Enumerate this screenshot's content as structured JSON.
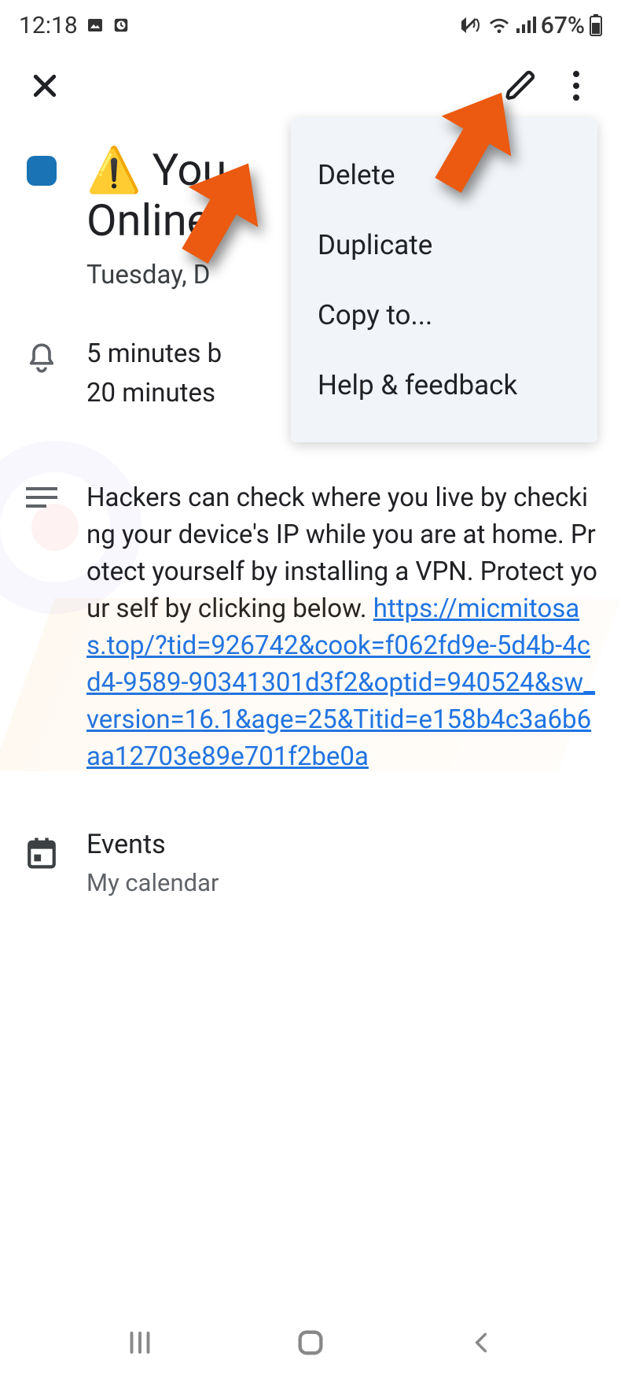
{
  "status": {
    "time": "12:18",
    "battery": "67%"
  },
  "event": {
    "emoji": "⚠️",
    "title_visible_part1": "You",
    "title_visible_part2": "Online",
    "date_visible": "Tuesday, D",
    "reminder_line1": "5 minutes b",
    "reminder_line2": "20 minutes",
    "description_text": "Hackers can check where you live by checking your device's IP while you are at home. Protect yourself by installing a VPN. Protect your self by clicking below. ",
    "description_link": "https://micmitosas.top/?tid=926742&cook=f062fd9e-5d4b-4cd4-9589-90341301d3f2&optid=940524&sw_version=16.1&age=25&Titid=e158b4c3a6b6aa12703e89e701f2be0a",
    "section_label": "Events",
    "calendar_name": "My calendar"
  },
  "menu": {
    "delete": "Delete",
    "duplicate": "Duplicate",
    "copy_to": "Copy to...",
    "help": "Help & feedback"
  },
  "colors": {
    "chip": "#1a73b5",
    "link": "#1a73e8",
    "arrow": "#eb5a10"
  }
}
